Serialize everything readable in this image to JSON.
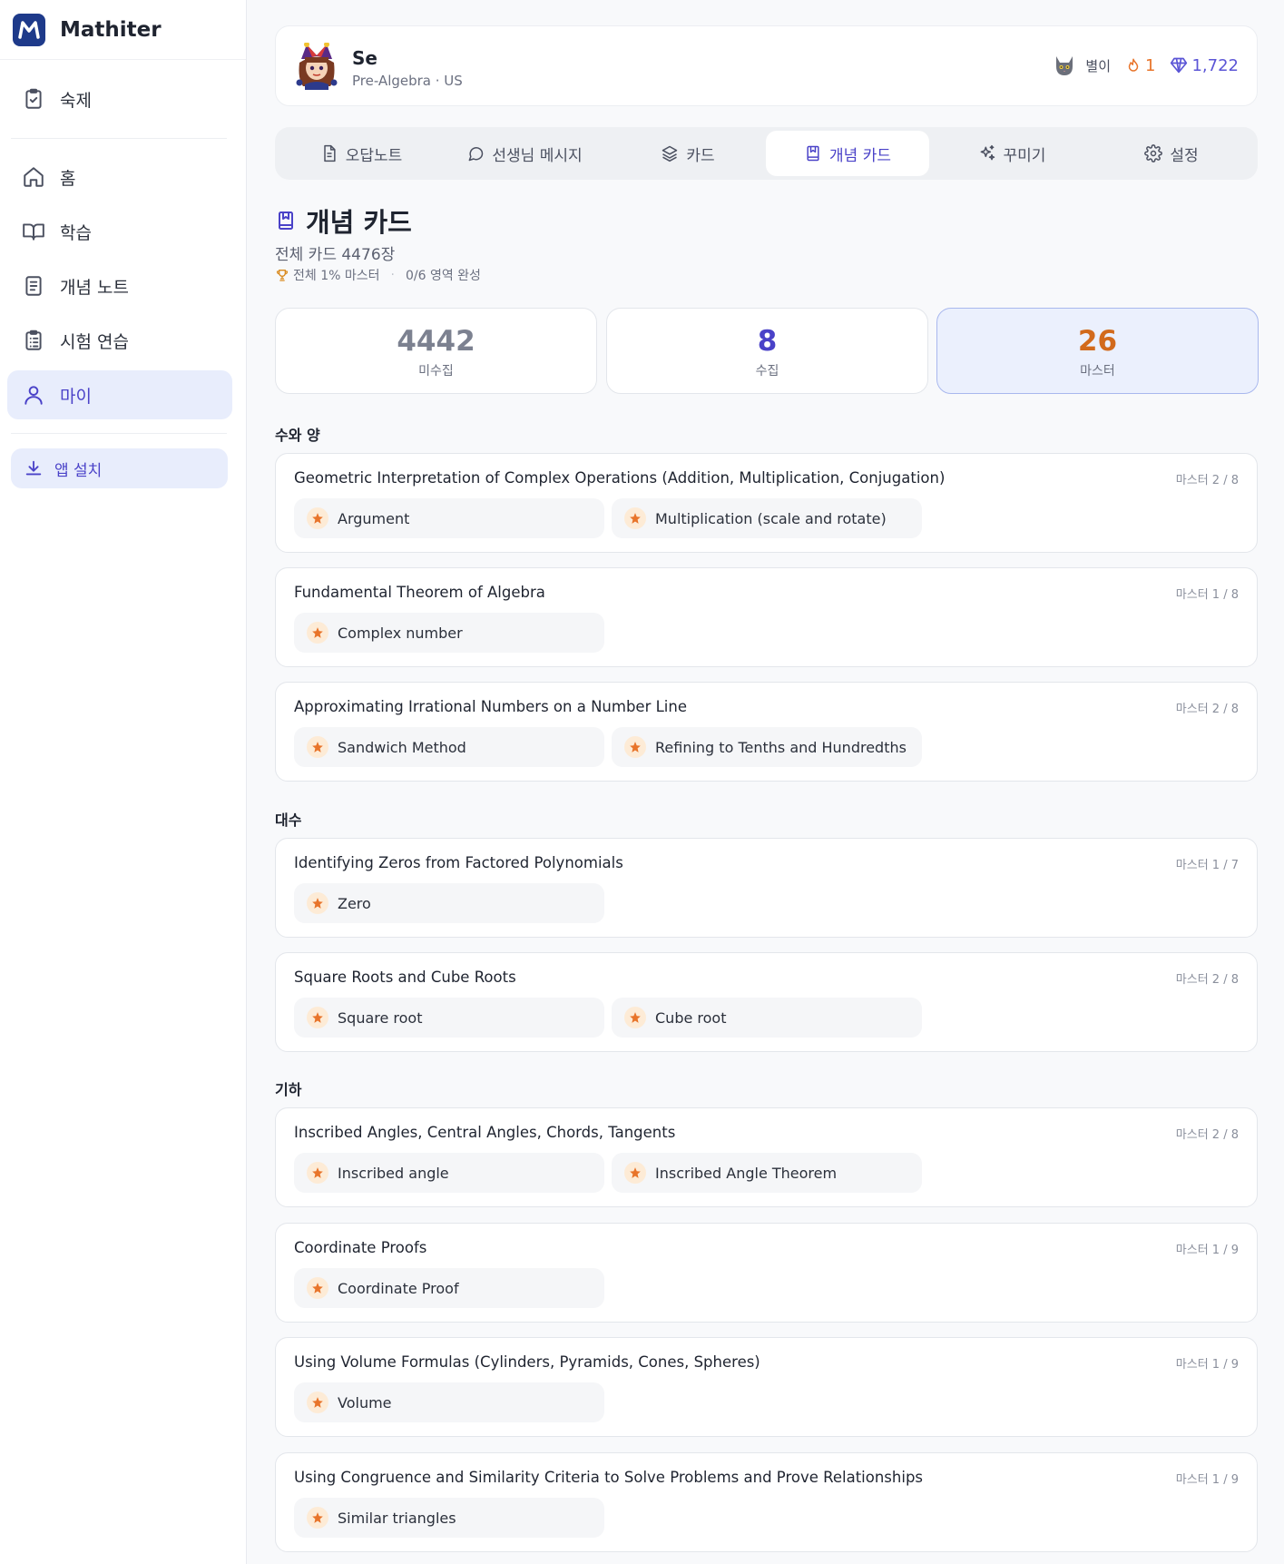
{
  "app": {
    "name": "Mathiter"
  },
  "sidebar": {
    "items": [
      {
        "label": "숙제",
        "icon": "clipboard-check-icon"
      },
      {
        "label": "홈",
        "icon": "home-icon"
      },
      {
        "label": "학습",
        "icon": "book-open-icon"
      },
      {
        "label": "개념 노트",
        "icon": "notebook-icon"
      },
      {
        "label": "시험 연습",
        "icon": "clipboard-list-icon"
      },
      {
        "label": "마이",
        "icon": "user-icon",
        "active": true
      }
    ],
    "install_label": "앱 설치"
  },
  "profile": {
    "name": "Se",
    "subtitle": "Pre-Algebra · US",
    "pet_name": "별이",
    "streak": "1",
    "gems": "1,722"
  },
  "tabs": [
    {
      "label": "오답노트",
      "icon": "file-text-icon"
    },
    {
      "label": "선생님 메시지",
      "icon": "message-circle-icon"
    },
    {
      "label": "카드",
      "icon": "layers-icon"
    },
    {
      "label": "개념 카드",
      "icon": "bookmark-book-icon",
      "active": true
    },
    {
      "label": "꾸미기",
      "icon": "sparkles-icon"
    },
    {
      "label": "설정",
      "icon": "gear-icon"
    }
  ],
  "page": {
    "title": "개념 카드",
    "total_cards": "전체 카드 4476장",
    "mastery_pct": "전체 1% 마스터",
    "areas_complete": "0/6 영역 완성"
  },
  "summary": [
    {
      "value": "4442",
      "label": "미수집",
      "color": "#7c8190"
    },
    {
      "value": "8",
      "label": "수집",
      "color": "#4a42c8"
    },
    {
      "value": "26",
      "label": "마스터",
      "color": "#d26a1c"
    }
  ],
  "sections": [
    {
      "label": "수와 양",
      "topics": [
        {
          "title": "Geometric Interpretation of Complex Operations (Addition, Multiplication, Conjugation)",
          "count": "마스터 2 / 8",
          "chips": [
            "Argument",
            "Multiplication (scale and rotate)"
          ]
        },
        {
          "title": "Fundamental Theorem of Algebra",
          "count": "마스터 1 / 8",
          "chips": [
            "Complex number"
          ]
        },
        {
          "title": "Approximating Irrational Numbers on a Number Line",
          "count": "마스터 2 / 8",
          "chips": [
            "Sandwich Method",
            "Refining to Tenths and Hundredths"
          ]
        }
      ]
    },
    {
      "label": "대수",
      "topics": [
        {
          "title": "Identifying Zeros from Factored Polynomials",
          "count": "마스터 1 / 7",
          "chips": [
            "Zero"
          ]
        },
        {
          "title": "Square Roots and Cube Roots",
          "count": "마스터 2 / 8",
          "chips": [
            "Square root",
            "Cube root"
          ]
        }
      ]
    },
    {
      "label": "기하",
      "topics": [
        {
          "title": "Inscribed Angles, Central Angles, Chords, Tangents",
          "count": "마스터 2 / 8",
          "chips": [
            "Inscribed angle",
            "Inscribed Angle Theorem"
          ]
        },
        {
          "title": "Coordinate Proofs",
          "count": "마스터 1 / 9",
          "chips": [
            "Coordinate Proof"
          ]
        },
        {
          "title": "Using Volume Formulas (Cylinders, Pyramids, Cones, Spheres)",
          "count": "마스터 1 / 9",
          "chips": [
            "Volume"
          ]
        },
        {
          "title": "Using Congruence and Similarity Criteria to Solve Problems and Prove Relationships",
          "count": "마스터 1 / 9",
          "chips": [
            "Similar triangles"
          ]
        }
      ]
    }
  ],
  "colors": {
    "accent": "#4a42c8",
    "star": "#e8742a",
    "active_bg": "#e8edfc"
  }
}
